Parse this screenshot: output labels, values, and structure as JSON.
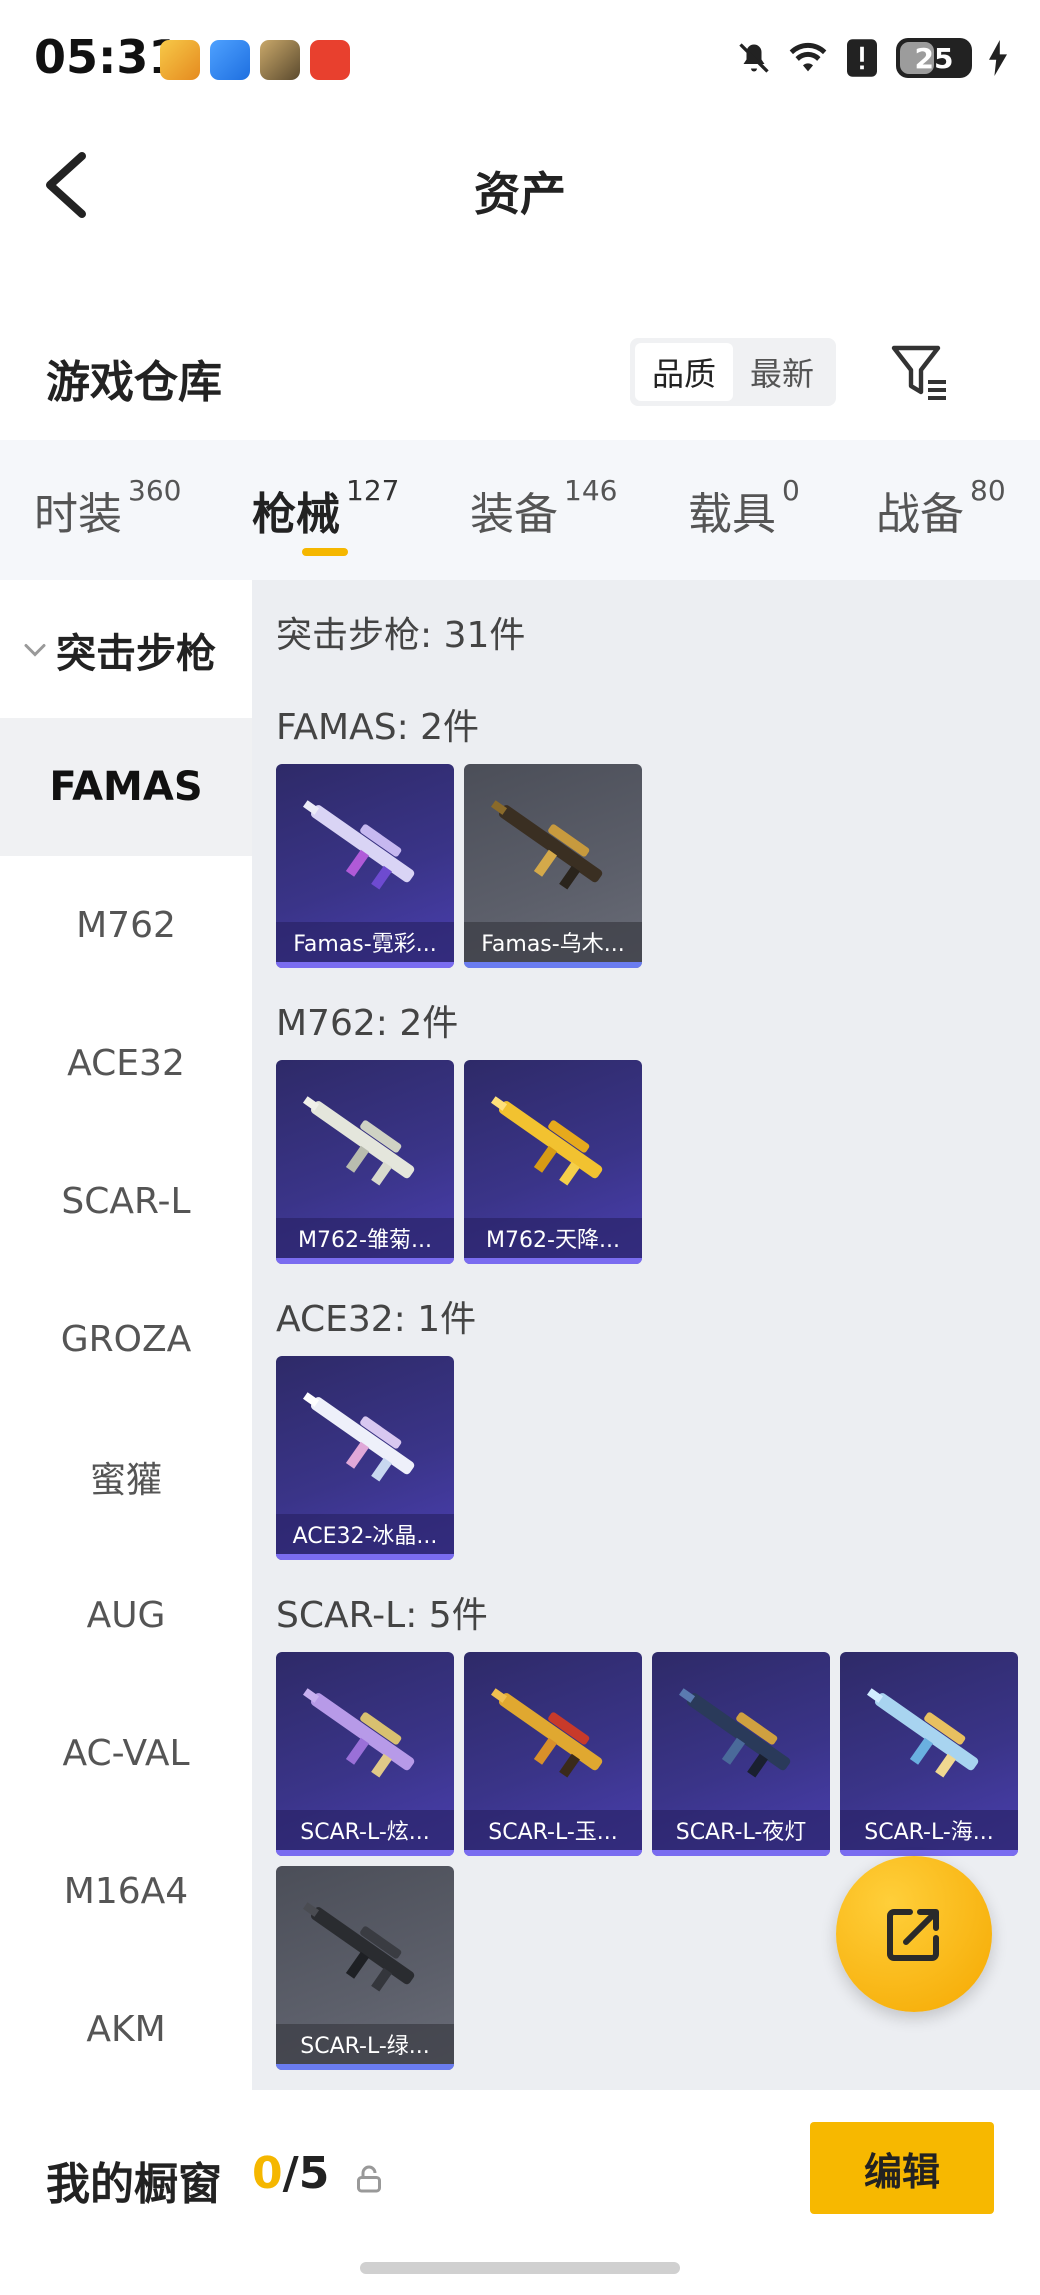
{
  "status_bar": {
    "time": "05:31",
    "battery": "25",
    "app_icons": [
      "game-app-icon",
      "weather-app-icon",
      "pubg-app-icon",
      "security-app-icon"
    ],
    "icons": [
      "mute-icon",
      "wifi-icon",
      "alert-icon",
      "battery-icon",
      "charging-icon"
    ]
  },
  "header": {
    "title": "资产"
  },
  "warehouse": {
    "title": "游戏仓库",
    "sort_options": [
      "品质",
      "最新"
    ],
    "selected_sort": "品质"
  },
  "tabs": [
    {
      "label": "时装",
      "count": "360"
    },
    {
      "label": "枪械",
      "count": "127",
      "active": true
    },
    {
      "label": "装备",
      "count": "146"
    },
    {
      "label": "载具",
      "count": "0"
    },
    {
      "label": "战备",
      "count": "80"
    }
  ],
  "sidebar": {
    "category": "突击步枪",
    "items": [
      "FAMAS",
      "M762",
      "ACE32",
      "SCAR-L",
      "GROZA",
      "蜜獾",
      "AUG",
      "AC-VAL",
      "M16A4",
      "AKM"
    ],
    "active": "FAMAS"
  },
  "content": {
    "summary": "突击步枪: 31件",
    "sections": [
      {
        "title": "FAMAS: 2件",
        "items": [
          {
            "name": "Famas-霓彩...",
            "style": "purple"
          },
          {
            "name": "Famas-乌木...",
            "style": "gray"
          }
        ]
      },
      {
        "title": "M762: 2件",
        "items": [
          {
            "name": "M762-雏菊...",
            "style": "purple"
          },
          {
            "name": "M762-天降...",
            "style": "purple"
          }
        ]
      },
      {
        "title": "ACE32: 1件",
        "items": [
          {
            "name": "ACE32-冰晶...",
            "style": "purple"
          }
        ]
      },
      {
        "title": "SCAR-L: 5件",
        "items": [
          {
            "name": "SCAR-L-炫...",
            "style": "purple"
          },
          {
            "name": "SCAR-L-玉...",
            "style": "purple"
          },
          {
            "name": "SCAR-L-夜灯",
            "style": "purple"
          },
          {
            "name": "SCAR-L-海...",
            "style": "purple"
          },
          {
            "name": "SCAR-L-绿...",
            "style": "gray"
          }
        ]
      }
    ]
  },
  "bottom_bar": {
    "label": "我的橱窗",
    "count_current": "0",
    "count_total": "/5",
    "edit_label": "编辑"
  },
  "colors": {
    "accent": "#f5b700",
    "card_purple": "#3a3488",
    "card_gray": "#5c5f6a"
  }
}
